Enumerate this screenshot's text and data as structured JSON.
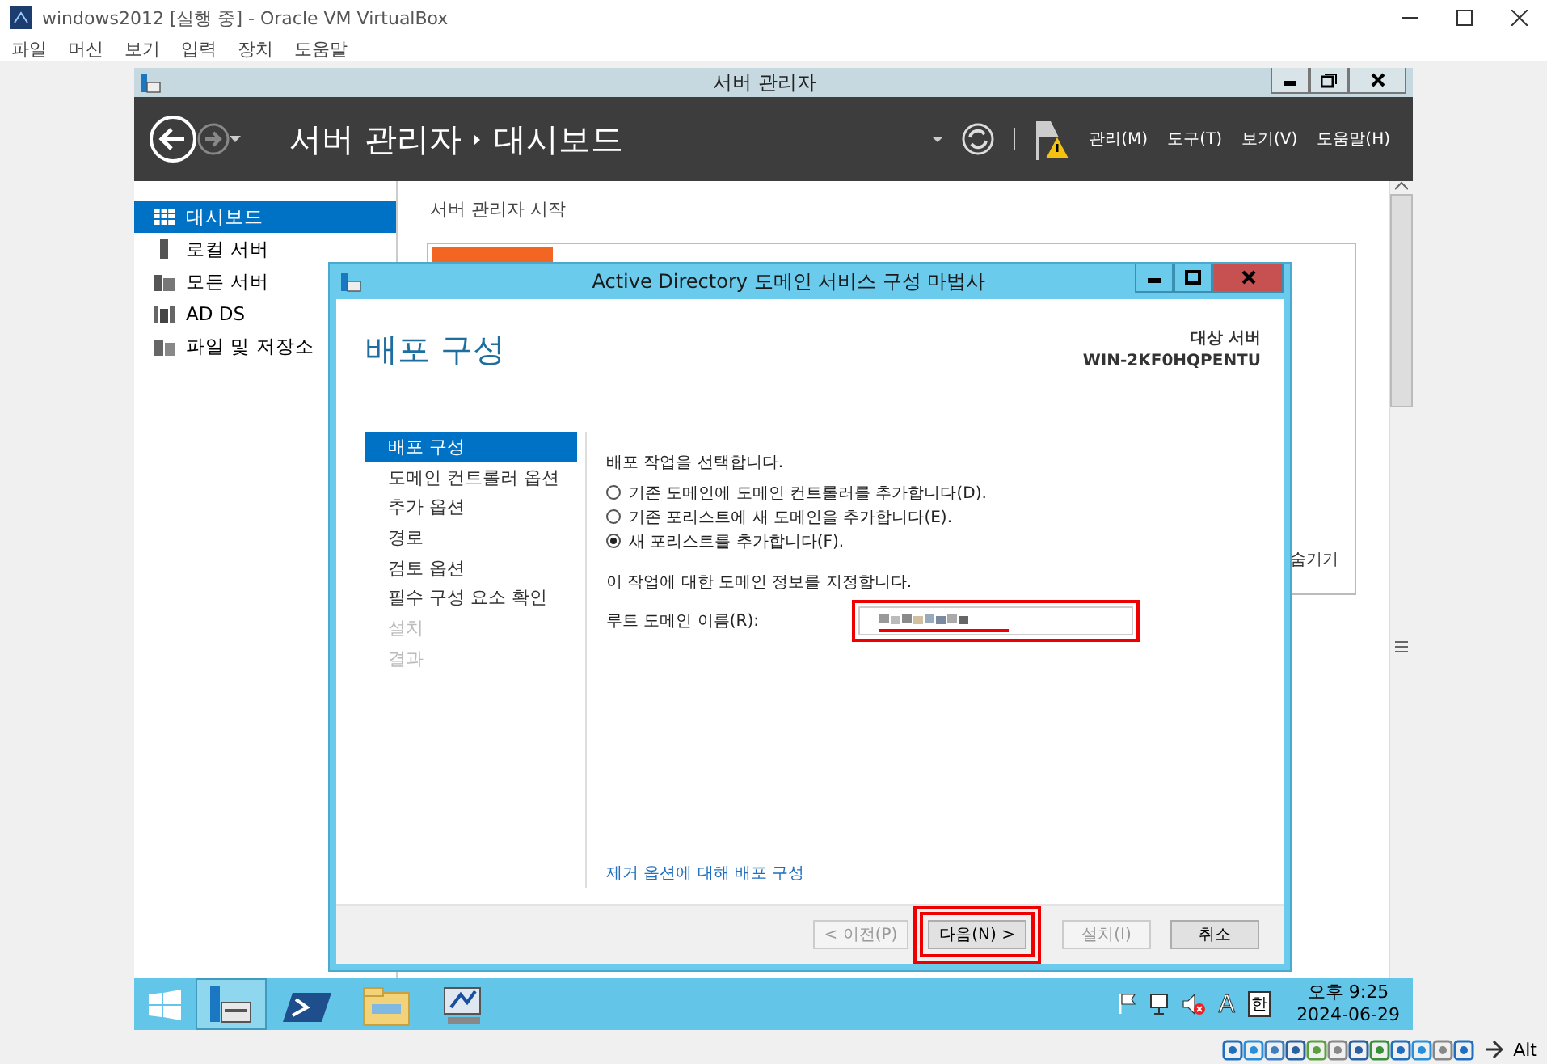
{
  "vbox": {
    "title": "windows2012 [실행 중] - Oracle VM VirtualBox",
    "menu": [
      "파일",
      "머신",
      "보기",
      "입력",
      "장치",
      "도움말"
    ],
    "host_key": "Alt"
  },
  "server_manager": {
    "title": "서버 관리자",
    "breadcrumb": [
      "서버 관리자",
      "대시보드"
    ],
    "menu": [
      "관리(M)",
      "도구(T)",
      "보기(V)",
      "도움말(H)"
    ],
    "nav": [
      {
        "label": "대시보드",
        "kind": "dashboard",
        "selected": true
      },
      {
        "label": "로컬 서버",
        "kind": "server",
        "selected": false
      },
      {
        "label": "모든 서버",
        "kind": "servers",
        "selected": false
      },
      {
        "label": "AD DS",
        "kind": "adds",
        "selected": false
      },
      {
        "label": "파일 및 저장소",
        "kind": "storage",
        "selected": false
      }
    ],
    "heading": "서버 관리자 시작",
    "hide_link": "숨기기"
  },
  "wizard": {
    "title": "Active Directory 도메인 서비스 구성 마법사",
    "heading": "배포 구성",
    "target_label": "대상 서버",
    "target_server": "WIN-2KF0HQPENTU",
    "steps": [
      {
        "label": "배포 구성",
        "selected": true,
        "disabled": false
      },
      {
        "label": "도메인 컨트롤러 옵션",
        "selected": false,
        "disabled": false
      },
      {
        "label": "추가 옵션",
        "selected": false,
        "disabled": false
      },
      {
        "label": "경로",
        "selected": false,
        "disabled": false
      },
      {
        "label": "검토 옵션",
        "selected": false,
        "disabled": false
      },
      {
        "label": "필수 구성 요소 확인",
        "selected": false,
        "disabled": false
      },
      {
        "label": "설치",
        "selected": false,
        "disabled": true
      },
      {
        "label": "결과",
        "selected": false,
        "disabled": true
      }
    ],
    "prompt": "배포 작업을 선택합니다.",
    "options": [
      {
        "label": "기존 도메인에 도메인 컨트롤러를 추가합니다(D).",
        "selected": false
      },
      {
        "label": "기존 포리스트에 새 도메인을 추가합니다(E).",
        "selected": false
      },
      {
        "label": "새 포리스트를 추가합니다(F).",
        "selected": true
      }
    ],
    "info": "이 작업에 대한 도메인 정보를 지정합니다.",
    "field": {
      "label": "루트 도메인 이름(R):",
      "redacted": true,
      "highlighted": true
    },
    "link": "제거 옵션에 대해 배포 구성",
    "buttons": [
      {
        "label": "< 이전(P)",
        "disabled": true,
        "highlighted": false
      },
      {
        "label": "다음(N) >",
        "disabled": false,
        "highlighted": true
      },
      {
        "label": "설치(I)",
        "disabled": true,
        "highlighted": false
      },
      {
        "label": "취소",
        "disabled": false,
        "highlighted": false
      }
    ]
  },
  "taskbar": {
    "apps": [
      {
        "kind": "server-manager",
        "selected": true
      },
      {
        "kind": "powershell",
        "selected": false
      },
      {
        "kind": "explorer",
        "selected": false
      },
      {
        "kind": "computer",
        "selected": false
      }
    ],
    "ime": "A",
    "lang": "한",
    "time": "오후 9:25",
    "date": "2024-06-29"
  }
}
